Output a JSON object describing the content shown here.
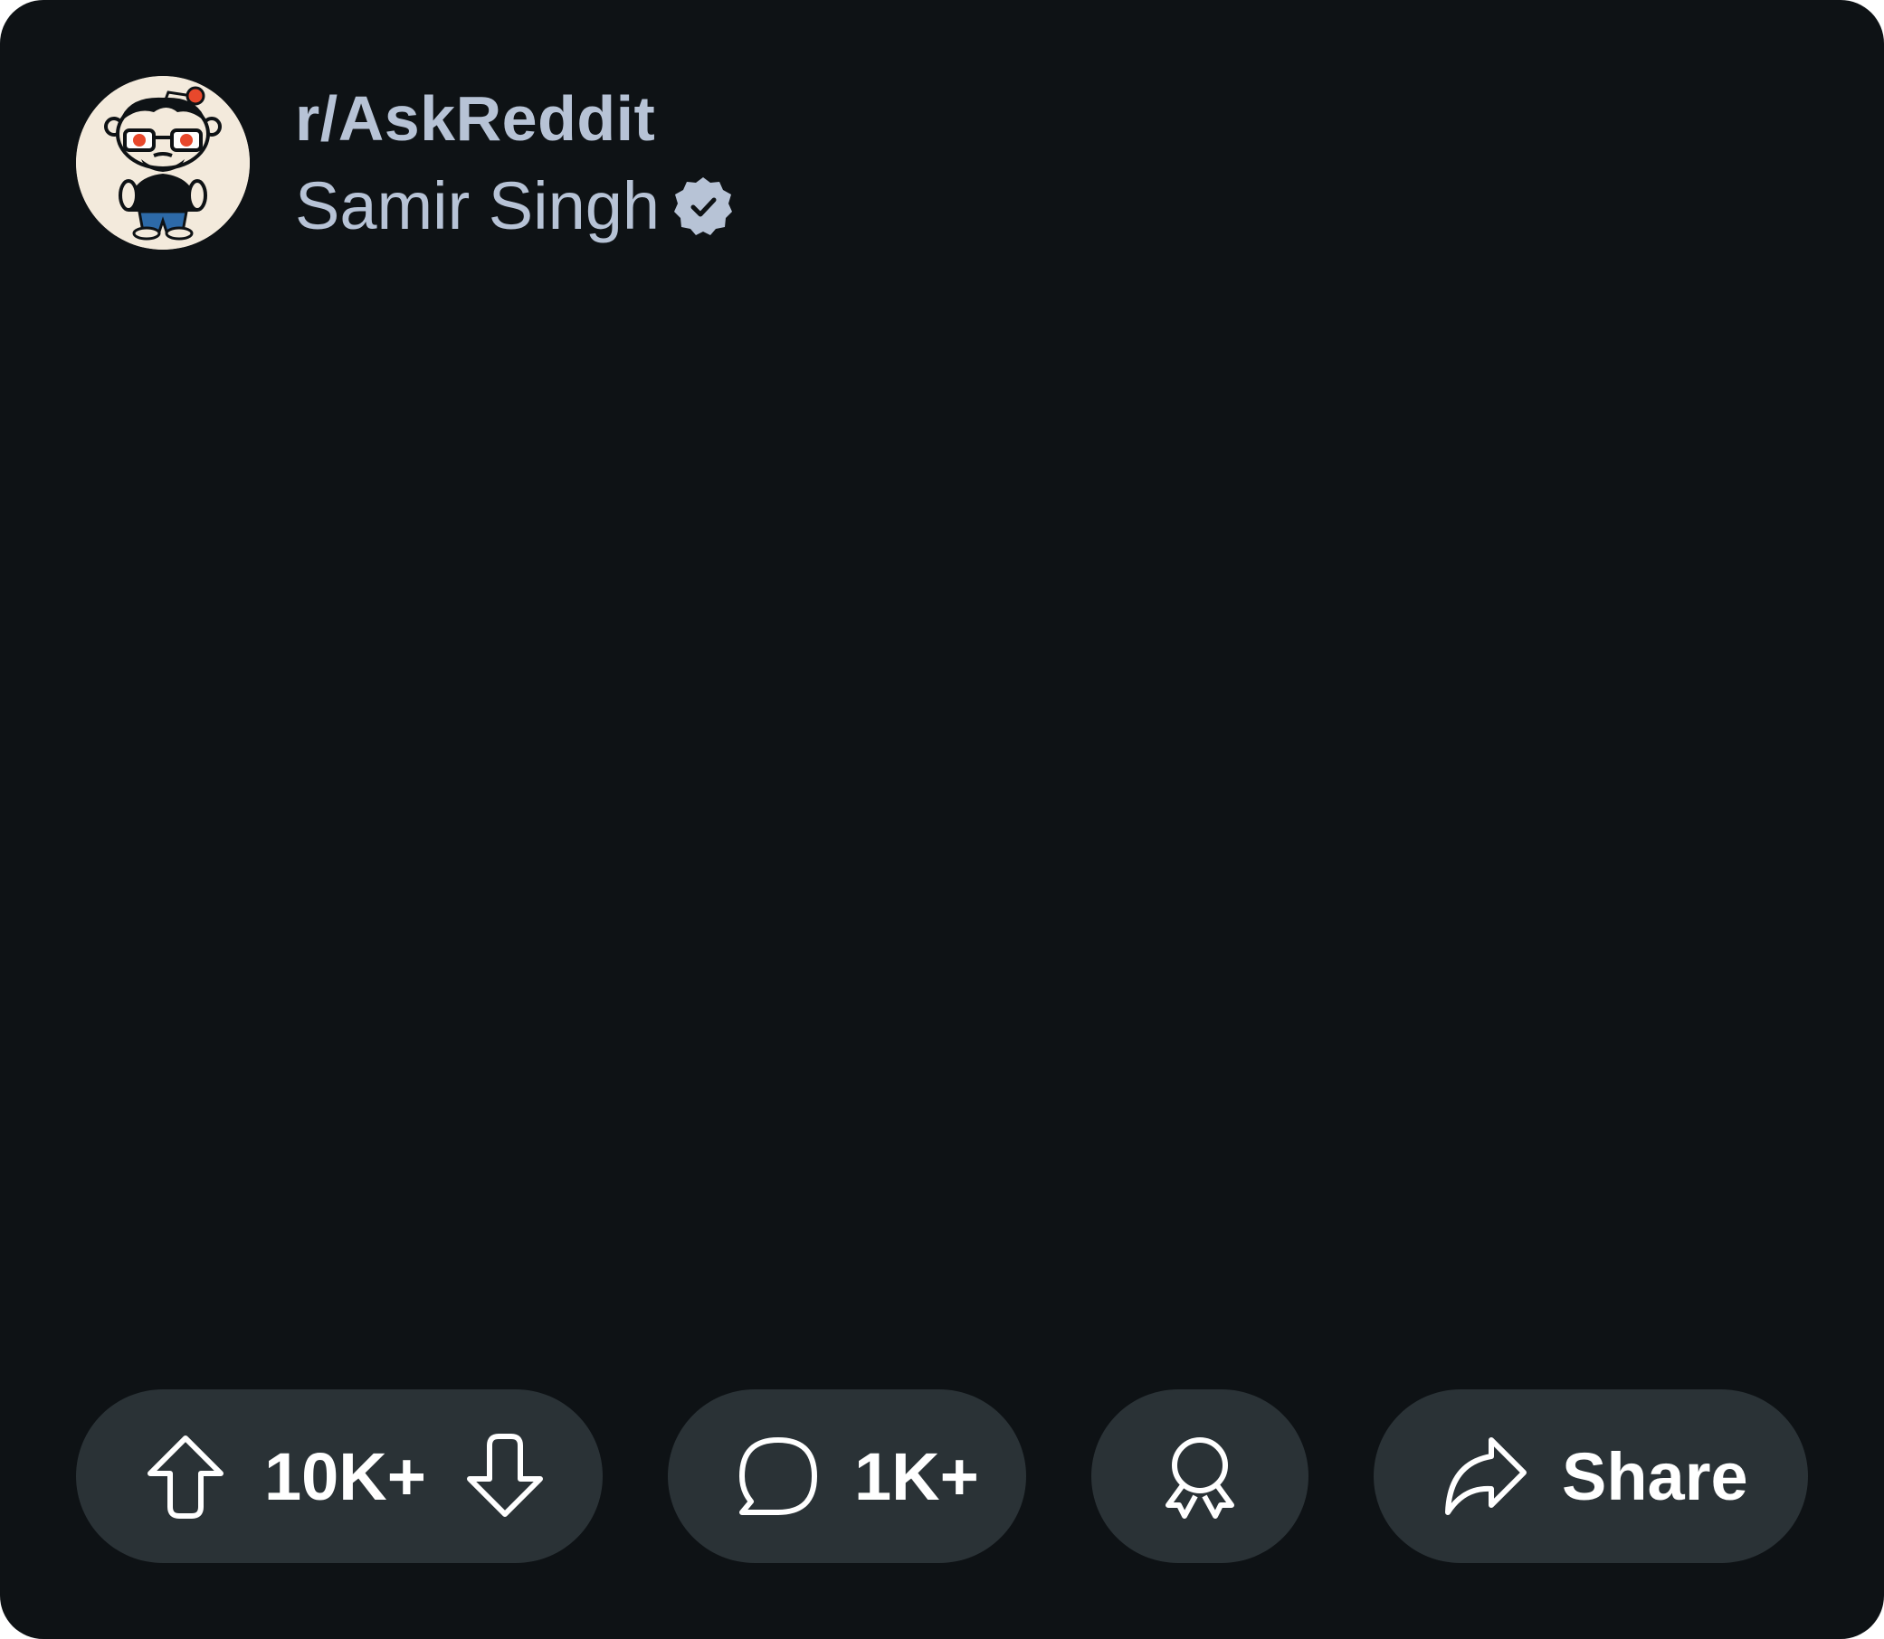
{
  "post": {
    "subreddit": "r/AskReddit",
    "author": "Samir Singh",
    "avatar_icon": "snoo-avatar-icon",
    "verified_icon": "verified-badge-icon"
  },
  "actions": {
    "vote_count": "10K+",
    "comment_count": "1K+",
    "share_label": "Share",
    "icons": {
      "upvote": "upvote-arrow-icon",
      "downvote": "downvote-arrow-icon",
      "comment": "comment-bubble-icon",
      "award": "award-medal-icon",
      "share": "share-arrow-icon"
    }
  },
  "colors": {
    "background": "#0e1215",
    "pill": "#2a3236",
    "meta_text": "#b7c3d6",
    "action_text": "#ffffff",
    "avatar_bg": "#f3eadc",
    "accent": "#e8482c"
  }
}
